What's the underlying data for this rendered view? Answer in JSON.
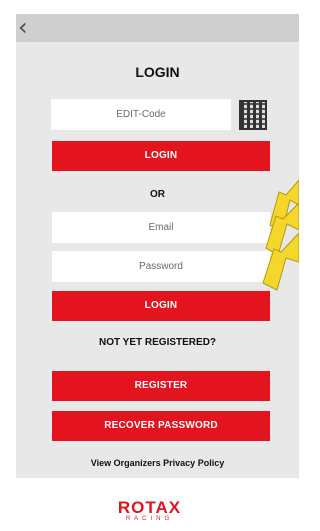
{
  "header": {
    "back_icon": "chevron-left-icon",
    "back_glyph": "‹"
  },
  "login": {
    "title": "LOGIN",
    "edit_code_placeholder": "EDIT-Code",
    "qr_icon": "qr-code-icon",
    "login_button_1": "LOGIN",
    "or_label": "OR",
    "email_placeholder": "Email",
    "password_placeholder": "Password",
    "login_button_2": "LOGIN",
    "not_registered": "NOT YET REGISTERED?",
    "register_button": "REGISTER",
    "recover_button": "RECOVER PASSWORD",
    "privacy_link": "View Organizers Privacy Policy"
  },
  "footer": {
    "brand": "ROTAX",
    "sub": "RACING"
  },
  "colors": {
    "accent": "#e3141e",
    "panel": "#e8e8e8",
    "topbar": "#cfcfcf",
    "arrow": "#f5d62a"
  }
}
